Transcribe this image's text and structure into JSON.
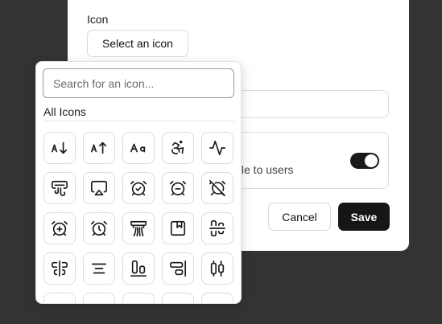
{
  "dialog": {
    "icon_label": "Icon",
    "select_icon_button": "Select an icon",
    "toggle_description": "ible to users",
    "toggle_on": true,
    "cancel_label": "Cancel",
    "save_label": "Save"
  },
  "picker": {
    "search_placeholder": "Search for an icon...",
    "section_title": "All Icons",
    "icons": [
      "arrow-down-a-z-icon",
      "arrow-up-a-z-icon",
      "case-sensitive-icon",
      "accessibility-icon",
      "activity-icon",
      "air-vent-icon",
      "airplay-icon",
      "alarm-check-icon",
      "alarm-minus-icon",
      "alarm-off-icon",
      "alarm-plus-icon",
      "alarm-clock-icon",
      "alarm-smoke-icon",
      "album-icon",
      "align-center-horizontal-icon",
      "align-center-vertical-icon",
      "align-center-icon",
      "align-end-horizontal-icon",
      "align-end-vertical-icon",
      "align-horizontal-distribute-icon"
    ]
  }
}
